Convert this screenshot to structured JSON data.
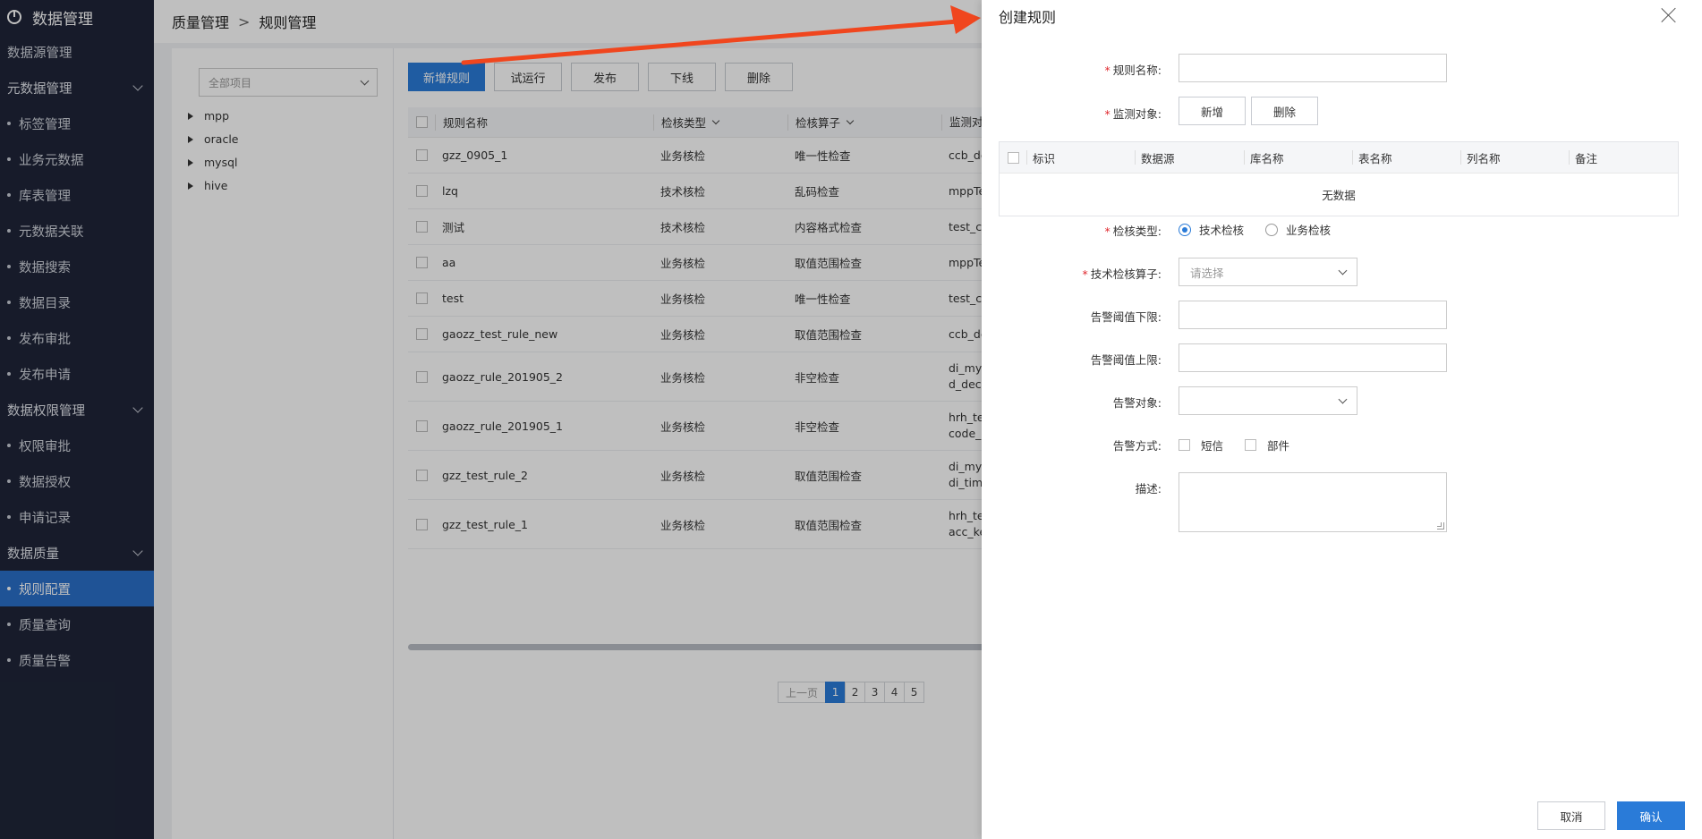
{
  "sidebar": {
    "brand": "数据管理",
    "items": [
      {
        "label": "数据源管理",
        "kind": "top"
      },
      {
        "label": "元数据管理",
        "kind": "group"
      },
      {
        "label": "标签管理",
        "kind": "sub"
      },
      {
        "label": "业务元数据",
        "kind": "sub"
      },
      {
        "label": "库表管理",
        "kind": "sub"
      },
      {
        "label": "元数据关联",
        "kind": "sub"
      },
      {
        "label": "数据搜索",
        "kind": "sub"
      },
      {
        "label": "数据目录",
        "kind": "sub"
      },
      {
        "label": "发布审批",
        "kind": "sub"
      },
      {
        "label": "发布申请",
        "kind": "sub"
      },
      {
        "label": "数据权限管理",
        "kind": "group"
      },
      {
        "label": "权限审批",
        "kind": "sub"
      },
      {
        "label": "数据授权",
        "kind": "sub"
      },
      {
        "label": "申请记录",
        "kind": "sub"
      },
      {
        "label": "数据质量",
        "kind": "group"
      },
      {
        "label": "规则配置",
        "kind": "sub",
        "active": true
      },
      {
        "label": "质量查询",
        "kind": "sub"
      },
      {
        "label": "质量告警",
        "kind": "sub"
      }
    ]
  },
  "breadcrumb": {
    "parent": "质量管理",
    "sep": ">",
    "current": "规则管理"
  },
  "tree": {
    "select_placeholder": "全部项目",
    "nodes": [
      "mpp",
      "oracle",
      "mysql",
      "hive"
    ]
  },
  "toolbar": {
    "add": "新增规则",
    "trial": "试运行",
    "publish": "发布",
    "offline": "下线",
    "delete": "删除"
  },
  "table": {
    "headers": {
      "name": "规则名称",
      "type": "检核类型",
      "operator": "检核算子",
      "monitor": "监测对"
    },
    "rows": [
      {
        "name": "gzz_0905_1",
        "type": "业务核检",
        "operator": "唯一性检查",
        "monitor": [
          "ccb_de"
        ]
      },
      {
        "name": "lzq",
        "type": "技术核检",
        "operator": "乱码检查",
        "monitor": [
          "mppTe"
        ]
      },
      {
        "name": "测试",
        "type": "技术核检",
        "operator": "内容格式检查",
        "monitor": [
          "test_cc"
        ]
      },
      {
        "name": "aa",
        "type": "业务核检",
        "operator": "取值范围检查",
        "monitor": [
          "mppTe"
        ]
      },
      {
        "name": "test",
        "type": "业务核检",
        "operator": "唯一性检查",
        "monitor": [
          "test_cc"
        ]
      },
      {
        "name": "gaozz_test_rule_new",
        "type": "业务核检",
        "operator": "取值范围检查",
        "monitor": [
          "ccb_de"
        ]
      },
      {
        "name": "gaozz_rule_201905_2",
        "type": "业务核检",
        "operator": "非空检查",
        "monitor": [
          "di_mys",
          "d_decir"
        ]
      },
      {
        "name": "gaozz_rule_201905_1",
        "type": "业务核检",
        "operator": "非空检查",
        "monitor": [
          "hrh_tes",
          "code_n"
        ]
      },
      {
        "name": "gzz_test_rule_2",
        "type": "业务核检",
        "operator": "取值范围检查",
        "monitor": [
          "di_mys",
          "di_time"
        ]
      },
      {
        "name": "gzz_test_rule_1",
        "type": "业务核检",
        "operator": "取值范围检查",
        "monitor": [
          "hrh_tes",
          "acc_ke"
        ]
      }
    ]
  },
  "pager": {
    "prev": "上一页",
    "pages": [
      "1",
      "2",
      "3",
      "4",
      "5"
    ],
    "current": "1"
  },
  "drawer": {
    "title": "创建规则",
    "labels": {
      "rule_name": "规则名称:",
      "monitor": "监测对象:",
      "check_type": "检核类型:",
      "operator": "技术检核算子:",
      "lower": "告警阈值下限:",
      "upper": "告警阈值上限:",
      "alarm_target": "告警对象:",
      "alarm_method": "告警方式:",
      "desc": "描述:"
    },
    "monitor_add": "新增",
    "monitor_delete": "删除",
    "monitor_table": {
      "headers": [
        "标识",
        "数据源",
        "库名称",
        "表名称",
        "列名称",
        "备注"
      ],
      "empty": "无数据"
    },
    "check_type_options": [
      "技术检核",
      "业务检核"
    ],
    "check_type_selected": "技术检核",
    "operator_placeholder": "请选择",
    "alarm_methods": [
      "短信",
      "部件"
    ],
    "cancel": "取消",
    "confirm": "确认"
  },
  "colors": {
    "primary": "#2a7bd8",
    "sidebar_bg": "#1f2538",
    "annotation_arrow": "#f0461e"
  }
}
